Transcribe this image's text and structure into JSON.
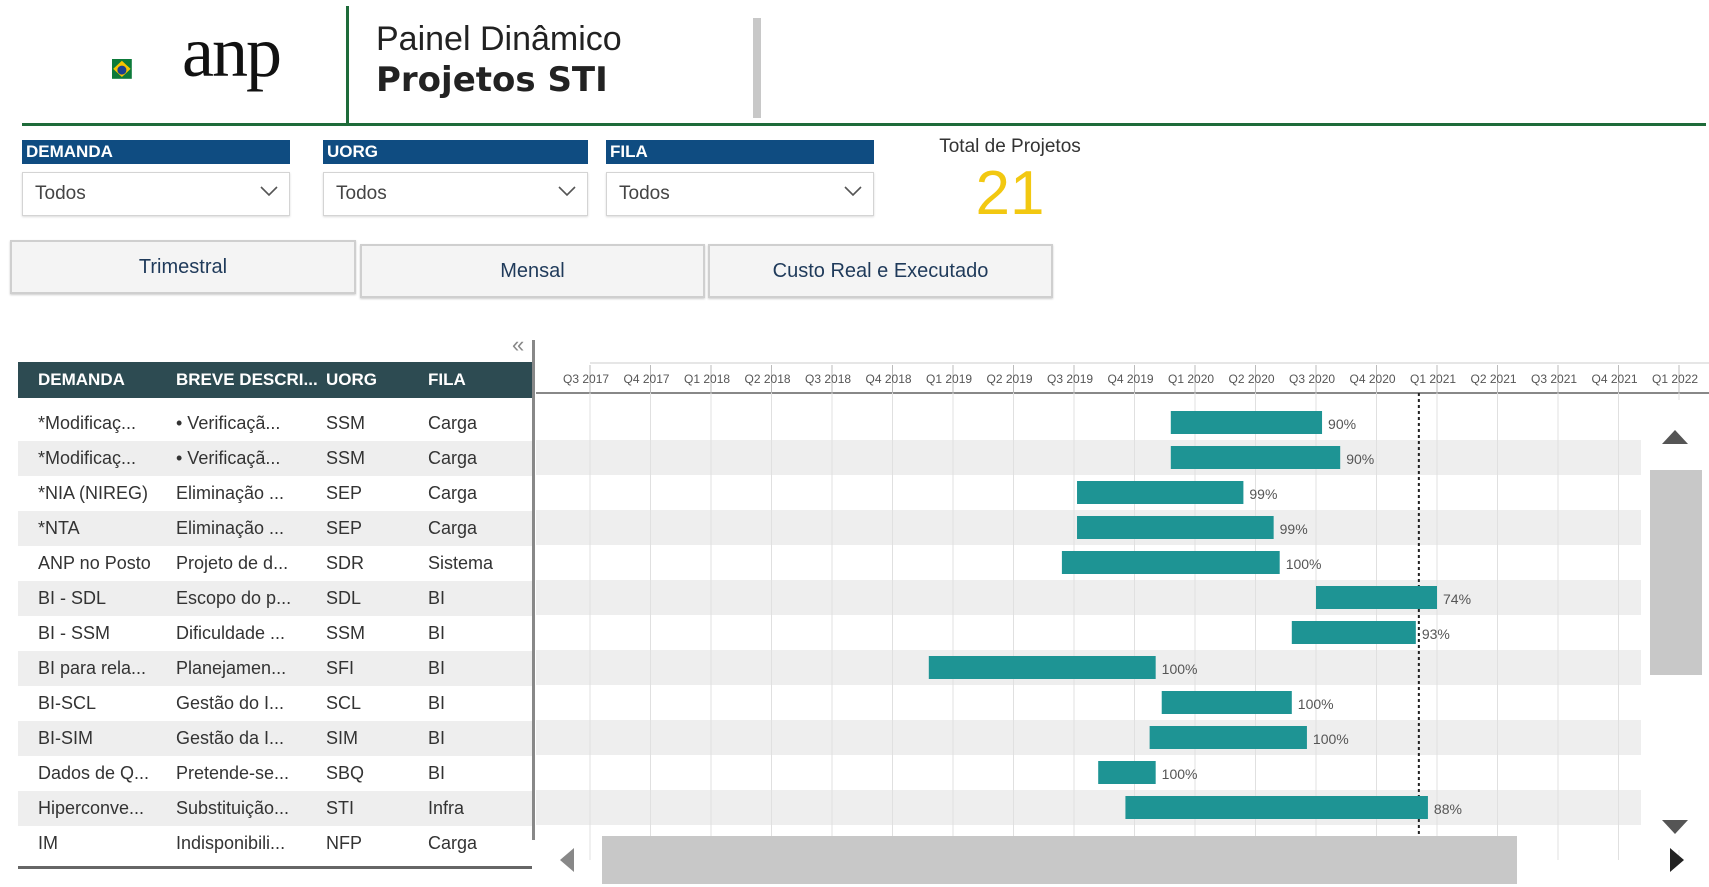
{
  "header": {
    "logo_text": "anp",
    "title_line1": "Painel Dinâmico",
    "title_line2": "Projetos STI"
  },
  "filters": [
    {
      "label": "DEMANDA",
      "value": "Todos"
    },
    {
      "label": "UORG",
      "value": "Todos"
    },
    {
      "label": "FILA",
      "value": "Todos"
    }
  ],
  "total": {
    "label": "Total de Projetos",
    "value": "21"
  },
  "buttons": [
    "Trimestral",
    "Mensal",
    "Custo Real e Executado"
  ],
  "table": {
    "columns": [
      "DEMANDA",
      "BREVE DESCRI...",
      "UORG",
      "FILA"
    ],
    "rows": [
      [
        "*Modificaç...",
        "• Verificaçã...",
        "SSM",
        "Carga"
      ],
      [
        "*Modificaç...",
        "• Verificaçã...",
        "SSM",
        "Carga"
      ],
      [
        "*NIA (NIREG)",
        "Eliminação ...",
        "SEP",
        "Carga"
      ],
      [
        "*NTA",
        "Eliminação ...",
        "SEP",
        "Carga"
      ],
      [
        "ANP no Posto",
        "Projeto de d...",
        "SDR",
        "Sistema"
      ],
      [
        "BI - SDL",
        "Escopo do p...",
        "SDL",
        "BI"
      ],
      [
        "BI - SSM",
        "Dificuldade ...",
        "SSM",
        "BI"
      ],
      [
        "BI para rela...",
        "Planejamen...",
        "SFI",
        "BI"
      ],
      [
        "BI-SCL",
        "Gestão do I...",
        "SCL",
        "BI"
      ],
      [
        "BI-SIM",
        "Gestão da I...",
        "SIM",
        "BI"
      ],
      [
        "Dados de Q...",
        "Pretende-se...",
        "SBQ",
        "BI"
      ],
      [
        "Hiperconve...",
        "Substituição...",
        "STI",
        "Infra"
      ],
      [
        "IM",
        "Indisponibili...",
        "NFP",
        "Carga"
      ]
    ]
  },
  "chart_data": {
    "type": "bar",
    "subtype": "gantt",
    "x_ticks": [
      "Q3 2017",
      "Q4 2017",
      "Q1 2018",
      "Q2 2018",
      "Q3 2018",
      "Q4 2018",
      "Q1 2019",
      "Q2 2019",
      "Q3 2019",
      "Q4 2019",
      "Q1 2020",
      "Q2 2020",
      "Q3 2020",
      "Q4 2020",
      "Q1 2021",
      "Q2 2021",
      "Q3 2021",
      "Q4 2021",
      "Q1 2022"
    ],
    "today_marker_quarter": 13.7,
    "bar_color": "#1e9494",
    "tasks": [
      {
        "start": 9.6,
        "end": 12.1,
        "label": "90%"
      },
      {
        "start": 9.6,
        "end": 12.4,
        "label": "90%"
      },
      {
        "start": 8.05,
        "end": 10.8,
        "label": "99%"
      },
      {
        "start": 8.05,
        "end": 11.3,
        "label": "99%"
      },
      {
        "start": 7.8,
        "end": 11.4,
        "label": "100%"
      },
      {
        "start": 12.0,
        "end": 14.0,
        "label": "74%"
      },
      {
        "start": 11.6,
        "end": 13.65,
        "label": "93%"
      },
      {
        "start": 5.6,
        "end": 9.35,
        "label": "100%"
      },
      {
        "start": 9.45,
        "end": 11.6,
        "label": "100%"
      },
      {
        "start": 9.25,
        "end": 11.85,
        "label": "100%"
      },
      {
        "start": 8.4,
        "end": 9.35,
        "label": "100%"
      },
      {
        "start": 8.85,
        "end": 13.85,
        "label": "88%"
      }
    ]
  }
}
